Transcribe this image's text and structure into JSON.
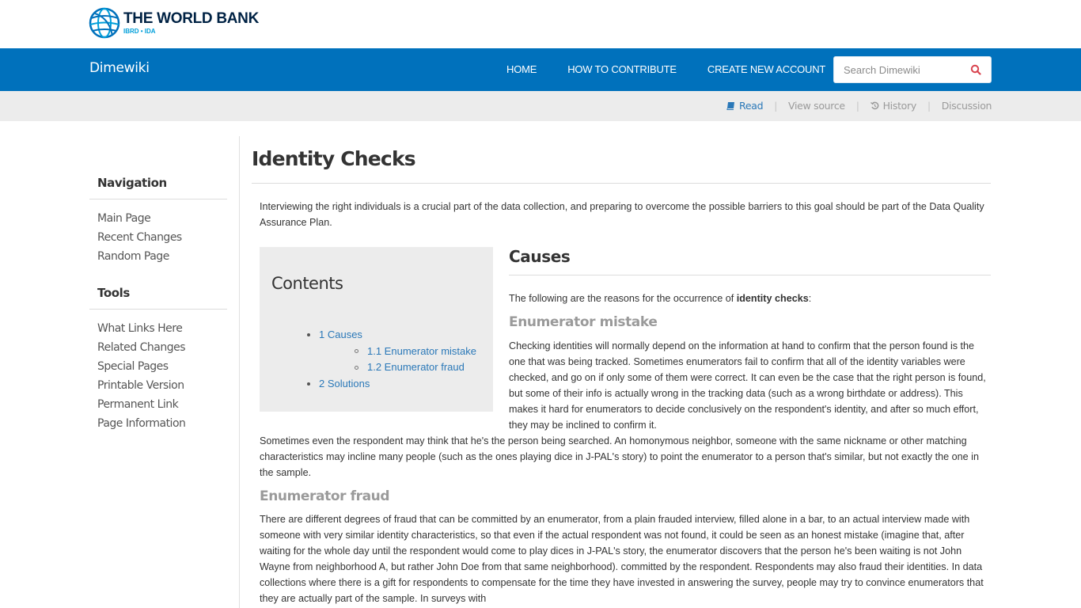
{
  "brand": {
    "org_name": "THE WORLD BANK",
    "org_sub": "IBRD • IDA",
    "site_name": "Dimewiki",
    "accent_color": "#0071bc"
  },
  "nav": {
    "links": [
      "HOME",
      "HOW TO CONTRIBUTE",
      "CREATE NEW ACCOUNT"
    ],
    "search_placeholder": "Search Dimewiki",
    "search_value": ""
  },
  "page_actions": {
    "read": "Read",
    "view_source": "View source",
    "history": "History",
    "discussion": "Discussion",
    "active": "Read"
  },
  "sidebar": {
    "navigation": {
      "title": "Navigation",
      "items": [
        "Main Page",
        "Recent Changes",
        "Random Page"
      ]
    },
    "tools": {
      "title": "Tools",
      "items": [
        "What Links Here",
        "Related Changes",
        "Special Pages",
        "Printable Version",
        "Permanent Link",
        "Page Information"
      ]
    }
  },
  "article": {
    "title": "Identity Checks",
    "intro": "Interviewing the right individuals is a crucial part of the data collection, and preparing to overcome the possible barriers to this goal should be part of the Data Quality Assurance Plan.",
    "toc": {
      "title": "Contents",
      "items": [
        {
          "label": "1 Causes",
          "level": 1
        },
        {
          "label": "1.1 Enumerator mistake",
          "level": 2
        },
        {
          "label": "1.2 Enumerator fraud",
          "level": 2
        },
        {
          "label": "2 Solutions",
          "level": 1
        }
      ]
    },
    "causes": {
      "heading": "Causes",
      "lead_prefix": "The following are the reasons for the occurrence of ",
      "lead_bold": "identity checks",
      "lead_suffix": ":",
      "mistake": {
        "heading": "Enumerator mistake",
        "para1": "Checking identities will normally depend on the information at hand to confirm that the person found is the one that was being tracked. Sometimes enumerators fail to confirm that all of the identity variables were checked, and go on if only some of them were correct. It can even be the case that the right person is found, but some of their info is actually wrong in the tracking data (such as a wrong birthdate or address). This makes it hard for enumerators to decide conclusively on the respondent's identity, and after so much effort, they may be inclined to confirm it.",
        "para2": "Sometimes even the respondent may think that he's the person being searched. An homonymous neighbor, someone with the same nickname or other matching characteristics may incline many people (such as the ones playing dice in J-PAL's story) to point the enumerator to a person that's similar, but not exactly the one in the sample."
      },
      "fraud": {
        "heading": "Enumerator fraud",
        "para": "There are different degrees of fraud that can be committed by an enumerator, from a plain frauded interview, filled alone in a bar, to an actual interview made with someone with very similar identity characteristics, so that even if the actual respondent was not found, it could be seen as an honest mistake (imagine that, after waiting for the whole day until the respondent would come to play dices in J-PAL's story, the enumerator discovers that the person he's been waiting is not John Wayne from neighborhood A, but rather John Doe from that same neighborhood). committed by the respondent. Respondents may also fraud their identities. In data collections where there is a gift for respondents to compensate for the time they have invested in answering the survey, people may try to convince enumerators that they are actually part of the sample. In surveys with"
      }
    }
  }
}
